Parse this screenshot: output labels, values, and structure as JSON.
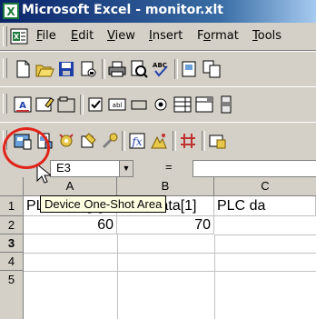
{
  "window": {
    "title": "Microsoft Excel - monitor.xlt"
  },
  "menu": {
    "items": [
      {
        "label": "File",
        "key": "F",
        "rest": "ile"
      },
      {
        "label": "Edit",
        "key": "E",
        "rest": "dit"
      },
      {
        "label": "View",
        "key": "V",
        "rest": "iew"
      },
      {
        "label": "Insert",
        "key": "I",
        "rest": "nsert"
      },
      {
        "label": "Format",
        "key": "o",
        "pre": "F",
        "rest": "rmat"
      },
      {
        "label": "Tools",
        "key": "T",
        "rest": "ools"
      }
    ]
  },
  "formula_bar": {
    "name_box": "E3",
    "equals": "="
  },
  "tooltip": "Device One-Shot Area",
  "sheet": {
    "columns": [
      "A",
      "B",
      "C"
    ],
    "rows": [
      "1",
      "2",
      "3",
      "4",
      "5"
    ],
    "active_row": "3",
    "cells": {
      "A1": "PLC data[0]",
      "B1": "PLC data[1]",
      "C1": "PLC da",
      "A2": "60",
      "B2": "70"
    }
  },
  "colors": {
    "highlight": "#e2231a",
    "titlebar": "#0a246a"
  }
}
